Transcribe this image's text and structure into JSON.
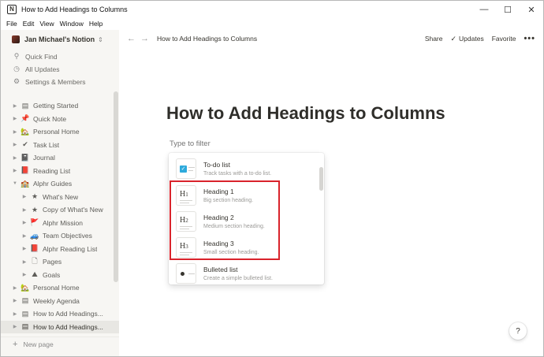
{
  "window": {
    "app_icon_glyph": "N",
    "title": "How to Add Headings to Columns",
    "controls": {
      "minimize": "—",
      "maximize": "☐",
      "close": "✕"
    }
  },
  "menubar": [
    "File",
    "Edit",
    "View",
    "Window",
    "Help"
  ],
  "sidebar": {
    "workspace_name": "Jan Michael's Notion",
    "workspace_chevron": "⇕",
    "utilities": [
      {
        "icon": "search-icon",
        "glyph": "⚲",
        "label": "Quick Find"
      },
      {
        "icon": "clock-icon",
        "glyph": "◷",
        "label": "All Updates"
      },
      {
        "icon": "gear-icon",
        "glyph": "⚙",
        "label": "Settings & Members"
      }
    ],
    "pages": [
      {
        "label": "Getting Started",
        "icon": "page-icon",
        "glyph": "▤",
        "indent": 0,
        "expanded": false
      },
      {
        "label": "Quick Note",
        "icon": "pushpin-icon",
        "glyph": "📌",
        "indent": 0,
        "expanded": false
      },
      {
        "label": "Personal Home",
        "icon": "house-icon",
        "glyph": "🏡",
        "indent": 0,
        "expanded": false
      },
      {
        "label": "Task List",
        "icon": "checkmark-icon",
        "glyph": "✔",
        "indent": 0,
        "expanded": false
      },
      {
        "label": "Journal",
        "icon": "notebook-icon",
        "glyph": "📓",
        "indent": 0,
        "expanded": false
      },
      {
        "label": "Reading List",
        "icon": "book-icon",
        "glyph": "📕",
        "indent": 0,
        "expanded": false
      },
      {
        "label": "Alphr Guides",
        "icon": "school-icon",
        "glyph": "🏫",
        "indent": 0,
        "expanded": true
      },
      {
        "label": "What's New",
        "icon": "star-icon",
        "glyph": "★",
        "indent": 1,
        "expanded": false
      },
      {
        "label": "Copy of What's New",
        "icon": "star-icon",
        "glyph": "★",
        "indent": 1,
        "expanded": false
      },
      {
        "label": "Alphr Mission",
        "icon": "flag-icon",
        "glyph": "🚩",
        "indent": 1,
        "expanded": false
      },
      {
        "label": "Team Objectives",
        "icon": "car-icon",
        "glyph": "🚙",
        "indent": 1,
        "expanded": false
      },
      {
        "label": "Alphr Reading List",
        "icon": "book-icon",
        "glyph": "📕",
        "indent": 1,
        "expanded": false
      },
      {
        "label": "Pages",
        "icon": "page-icon",
        "glyph": "🗋",
        "indent": 1,
        "expanded": false
      },
      {
        "label": "Goals",
        "icon": "mountain-icon",
        "glyph": "⛰",
        "indent": 1,
        "expanded": false
      },
      {
        "label": "Personal Home",
        "icon": "house-icon",
        "glyph": "🏡",
        "indent": 0,
        "expanded": false
      },
      {
        "label": "Weekly Agenda",
        "icon": "page-icon",
        "glyph": "▤",
        "indent": 0,
        "expanded": false
      },
      {
        "label": "How to Add Headings...",
        "icon": "page-icon",
        "glyph": "▤",
        "indent": 0,
        "expanded": false
      },
      {
        "label": "How to Add Headings...",
        "icon": "page-icon",
        "glyph": "▤",
        "indent": 0,
        "expanded": false,
        "selected": true
      }
    ],
    "new_page_label": "New page"
  },
  "topbar": {
    "breadcrumb": "How to Add Headings to Columns",
    "share": "Share",
    "updates": "Updates",
    "favorite": "Favorite",
    "more": "•••"
  },
  "page": {
    "title": "How to Add Headings to Columns",
    "filter_placeholder": "Type to filter"
  },
  "block_menu": [
    {
      "type": "todo",
      "title": "To-do list",
      "desc": "Track tasks with a to-do list."
    },
    {
      "type": "h1",
      "thumb_letter": "H",
      "thumb_num": "1",
      "title": "Heading 1",
      "desc": "Big section heading."
    },
    {
      "type": "h2",
      "thumb_letter": "H",
      "thumb_num": "2",
      "title": "Heading 2",
      "desc": "Medium section heading."
    },
    {
      "type": "h3",
      "thumb_letter": "H",
      "thumb_num": "3",
      "title": "Heading 3",
      "desc": "Small section heading."
    },
    {
      "type": "bullet",
      "title": "Bulleted list",
      "desc": "Create a simple bulleted list."
    }
  ],
  "help_label": "?",
  "colors": {
    "highlight": "#d9232b",
    "sidebar_bg": "#f7f6f3",
    "todo_blue": "#2eaadc"
  }
}
